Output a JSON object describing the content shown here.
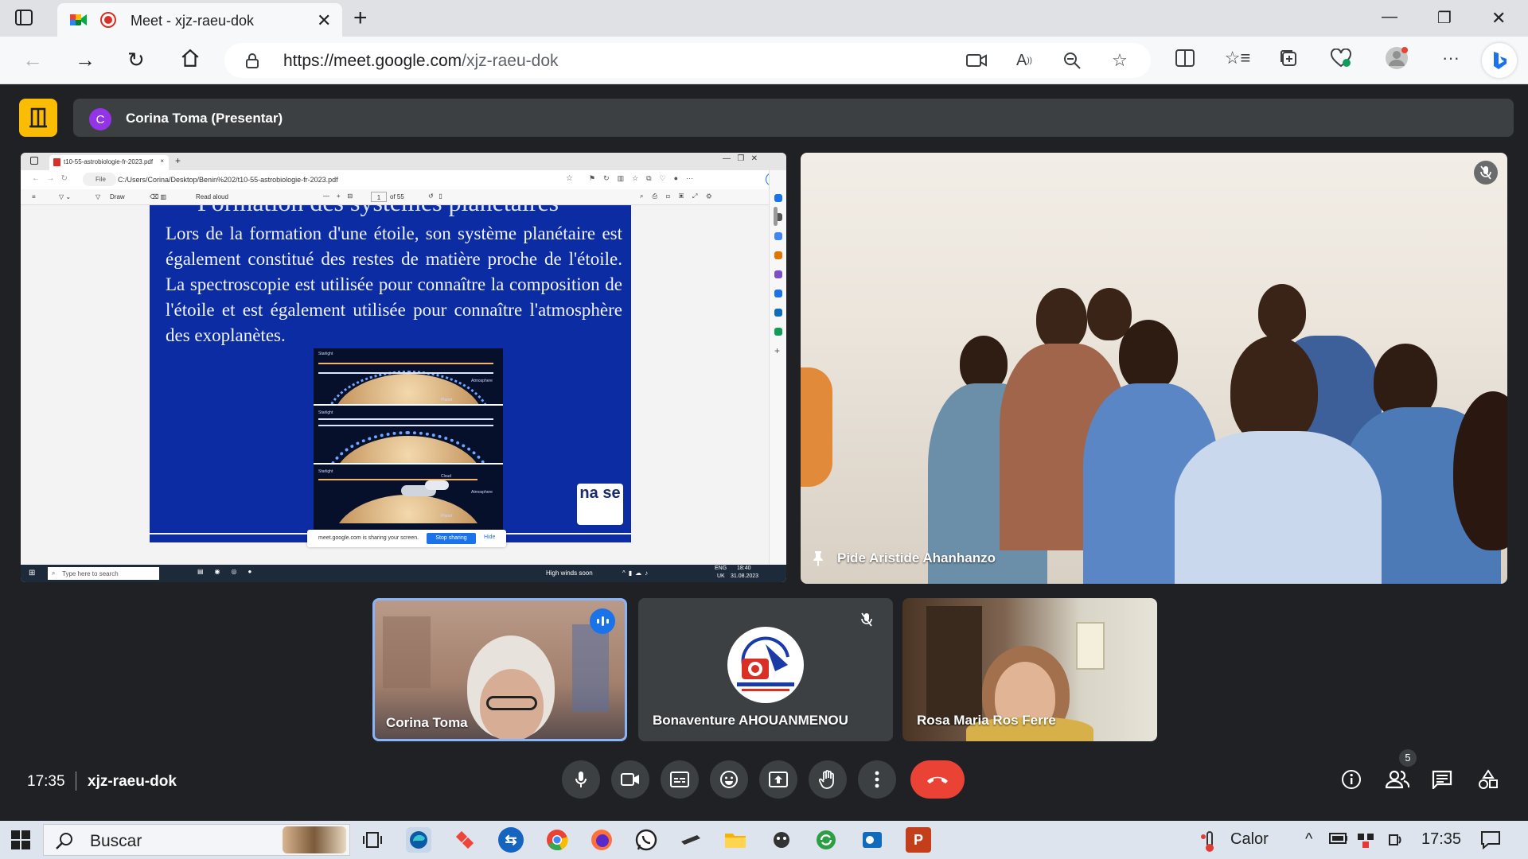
{
  "browser": {
    "tab_title": "Meet - xjz-raeu-dok",
    "url_host": "https://meet.google.com",
    "url_path": "/xjz-raeu-dok"
  },
  "meet": {
    "presenter_initial": "C",
    "presenter_label": "Corina Toma (Presentar)",
    "main_participant": "Pide Aristide Ahanhanzo",
    "participants": [
      {
        "name": "Corina Toma"
      },
      {
        "name": "Bonaventure AHOUANMENOU"
      },
      {
        "name": "Rosa Maria Ros Ferre"
      }
    ],
    "time": "17:35",
    "meeting_code": "xjz-raeu-dok",
    "participant_count": "5"
  },
  "shared_screen": {
    "tab_title": "t10-55-astrobiologie-fr-2023.pdf",
    "file_label": "File",
    "path": "C:/Users/Corina/Desktop/Benin%202/t10-55-astrobiologie-fr-2023.pdf",
    "draw_label": "Draw",
    "read_aloud_label": "Read aloud",
    "page_current": "1",
    "page_total": "of 55",
    "slide_heading": "Formation des systèmes planétaires",
    "slide_body": "Lors de la formation d'une étoile, son système planétaire est également constitué des restes de matière proche de l'étoile. La spectroscopie est utilisée pour connaître la composition de l'étoile et est également utilisée pour connaître l'atmosphère des exoplanètes.",
    "figure_labels": {
      "starlight": "Starlight",
      "atmosphere": "Atmosphere",
      "planet": "Planet",
      "cloud": "Cloud"
    },
    "nase_logo": "na se",
    "share_notice": "meet.google.com is sharing your screen.",
    "stop_sharing": "Stop sharing",
    "hide": "Hide",
    "search_placeholder": "Type here to search",
    "weather": "High winds soon",
    "lang": "ENG",
    "region": "UK",
    "clock_time": "18:40",
    "clock_date": "31.08.2023"
  },
  "taskbar": {
    "search_text": "Buscar",
    "weather_text": "Calor",
    "time": "17:35"
  },
  "colors": {
    "meet_bg": "#202124",
    "hangup": "#ea4335",
    "speaking": "#1a73e8",
    "layout_btn": "#fbbc04",
    "slide_bg": "#0b2ca3"
  }
}
